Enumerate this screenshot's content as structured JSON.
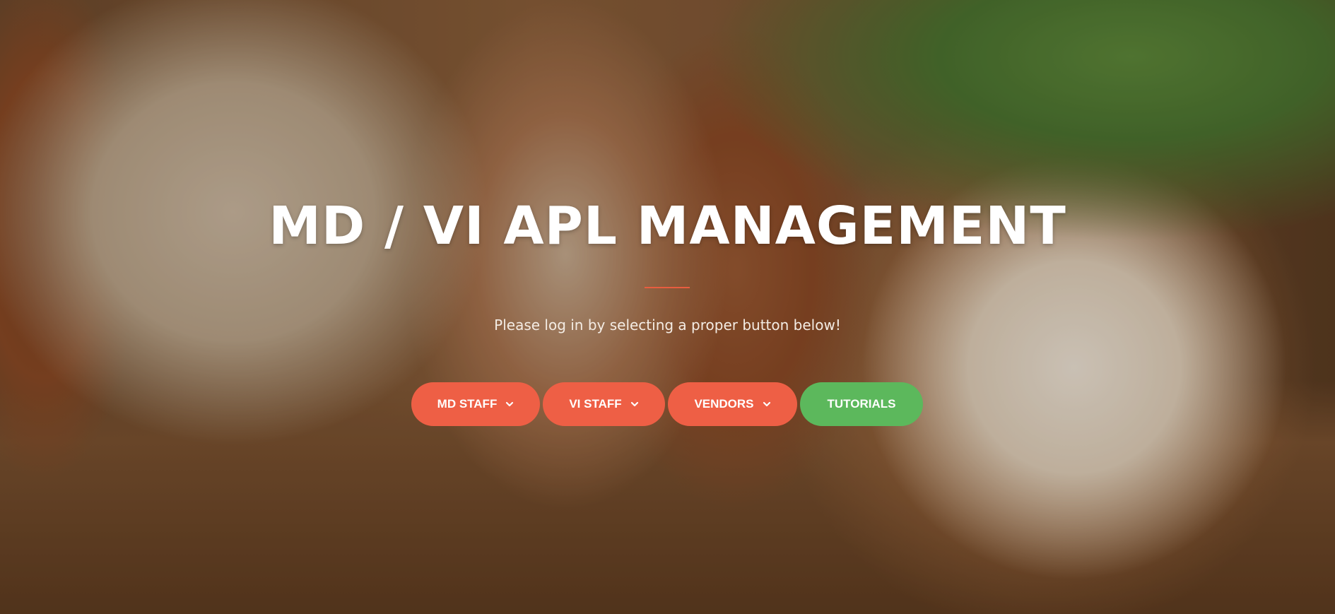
{
  "hero": {
    "title": "MD / VI APL MANAGEMENT",
    "subtitle": "Please log in by selecting a proper button below!"
  },
  "buttons": [
    {
      "label": "MD STAFF",
      "has_dropdown": true,
      "color": "#ee5f45",
      "icon": "chevron-down-icon"
    },
    {
      "label": "VI STAFF",
      "has_dropdown": true,
      "color": "#ee5f45",
      "icon": "chevron-down-icon"
    },
    {
      "label": "VENDORS",
      "has_dropdown": true,
      "color": "#ee5f45",
      "icon": "chevron-down-icon"
    },
    {
      "label": "TUTORIALS",
      "has_dropdown": false,
      "color": "#5cb85c"
    }
  ],
  "colors": {
    "accent": "#ee5f45",
    "success": "#5cb85c",
    "divider": "#e85d3f",
    "title_text": "#ffffff"
  }
}
